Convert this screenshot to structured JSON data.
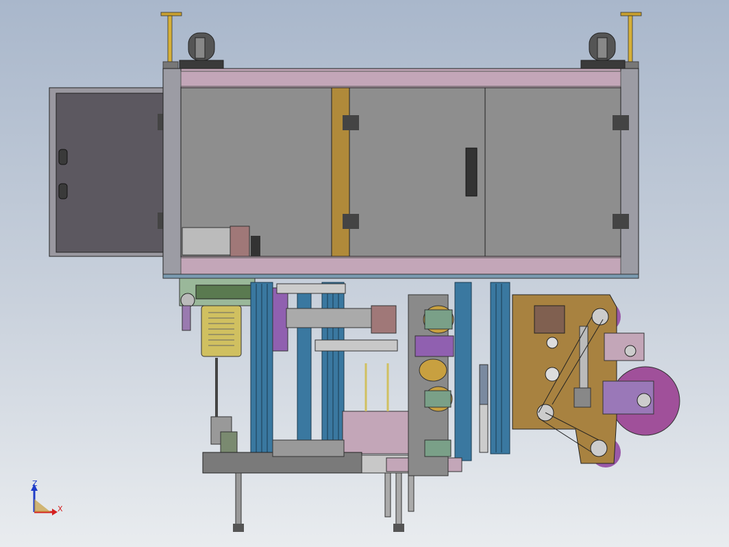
{
  "axis_triad": {
    "z_label": "Z",
    "x_label": "X",
    "z_color": "#1f3cc8",
    "x_color": "#d42020",
    "origin_color": "#c8a040"
  },
  "colors": {
    "frame_pink": "#c3a6b8",
    "panel_gray": "#8e8e8e",
    "door_dark": "#5c5860",
    "post_gold": "#b08a3a",
    "rail_blue": "#3a78a0",
    "plate_brown": "#a88240",
    "roller_magenta": "#a0509a",
    "motor_green": "#7aa088",
    "yellow_part": "#d0c060"
  }
}
